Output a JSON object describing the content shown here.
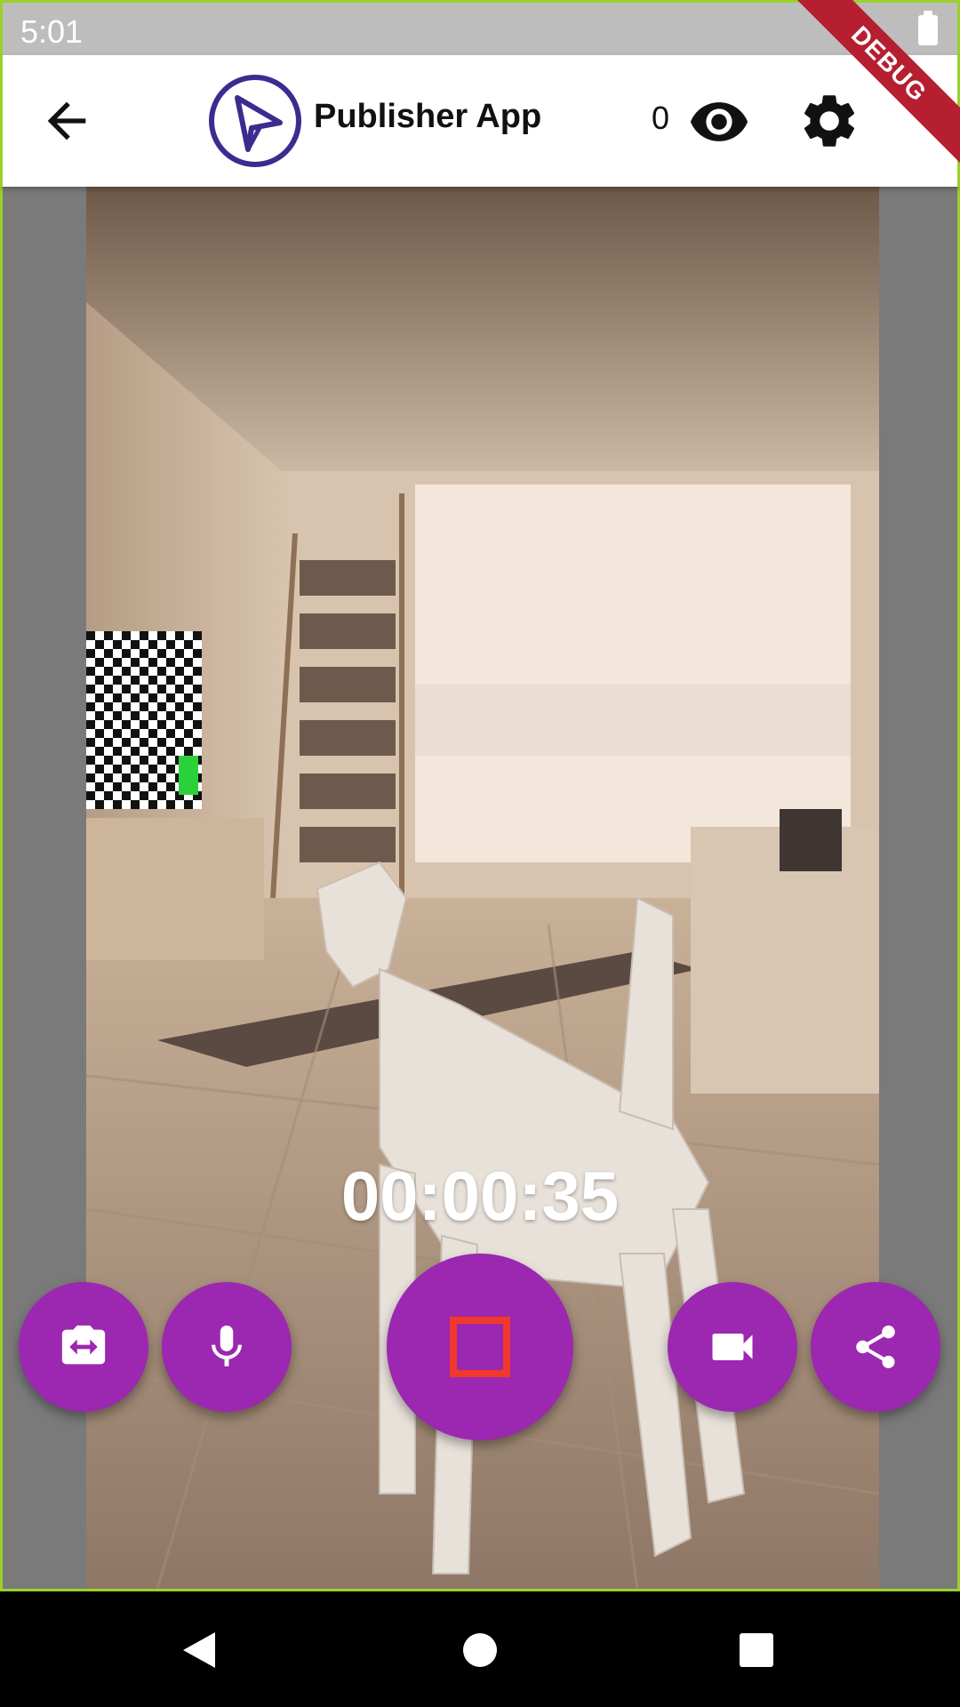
{
  "status_bar": {
    "time": "5:01"
  },
  "debug_banner": "DEBUG",
  "app_bar": {
    "title": "Publisher App",
    "viewer_count": "0"
  },
  "stream": {
    "elapsed": "00:00:35"
  },
  "controls": {
    "switch_camera": "switch-camera-icon",
    "microphone": "mic-icon",
    "record": "stop-icon",
    "video": "videocam-icon",
    "share": "share-icon"
  },
  "colors": {
    "accent": "#9c27b0",
    "stop": "#f0392b",
    "logo": "#3d2b8f",
    "debug": "#b51f2f"
  }
}
